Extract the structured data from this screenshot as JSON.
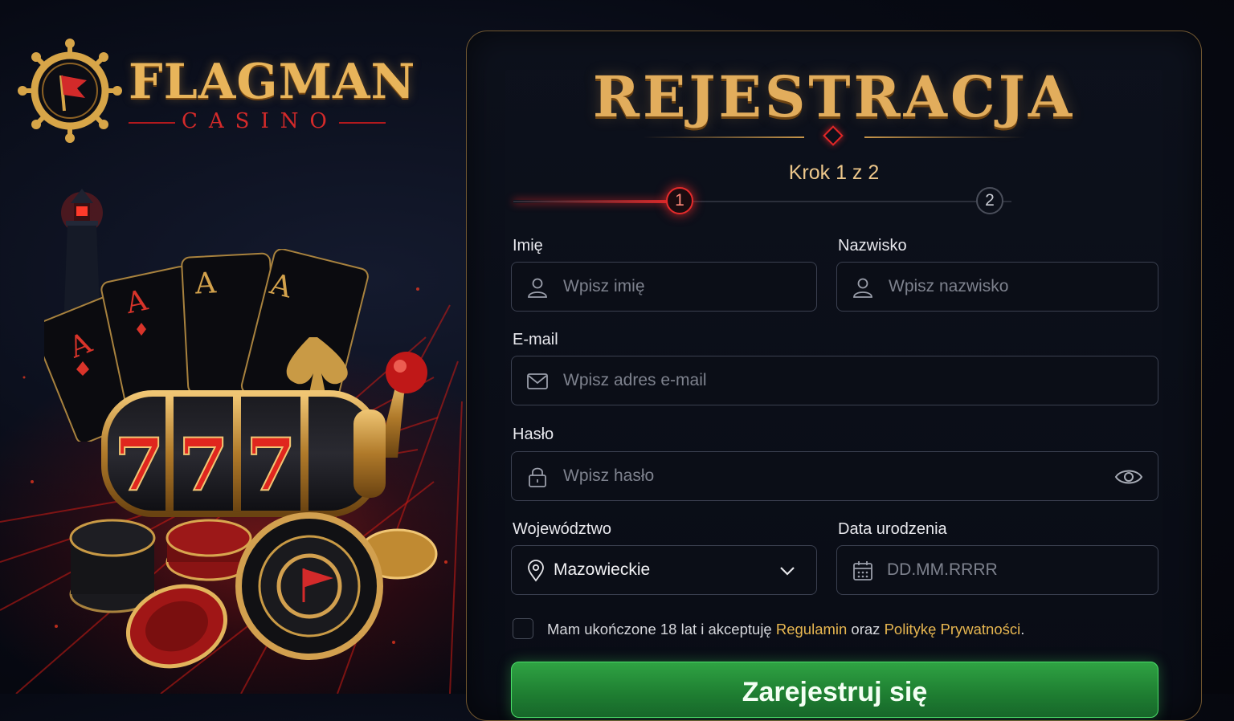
{
  "brand": {
    "name": "FLAGMAN",
    "sub": "CASINO",
    "slot_symbols": [
      "7",
      "7",
      "7"
    ],
    "card_ranks": [
      "A",
      "A",
      "A",
      "A"
    ]
  },
  "form": {
    "title": "REJESTRACJA",
    "step": {
      "text": "Krok 1 z 2",
      "current": 1,
      "total": 2,
      "labels": [
        "1",
        "2"
      ],
      "progress": 0.5
    },
    "first_name": {
      "label": "Imię",
      "placeholder": "Wpisz imię",
      "icon": "user-icon"
    },
    "last_name": {
      "label": "Nazwisko",
      "placeholder": "Wpisz nazwisko",
      "icon": "user-icon"
    },
    "email": {
      "label": "E-mail",
      "placeholder": "Wpisz adres e-mail",
      "icon": "mail-icon"
    },
    "password": {
      "label": "Hasło",
      "placeholder": "Wpisz hasło",
      "icon": "lock-icon",
      "toggle_icon": "eye-icon"
    },
    "region": {
      "label": "Województwo",
      "value": "Mazowieckie",
      "icon": "location-pin-icon",
      "dropdown_icon": "chevron-down-icon"
    },
    "birthdate": {
      "label": "Data urodzenia",
      "placeholder": "DD.MM.RRRR",
      "icon": "calendar-icon"
    },
    "consent": {
      "checked": false,
      "text_before": "Mam ukończone 18 lat i akceptuję ",
      "link_terms": "Regulamin",
      "text_mid": " oraz ",
      "link_privacy": "Politykę Prywatności",
      "text_after": "."
    },
    "submit_label": "Zarejestruj się"
  },
  "colors": {
    "gold": "#e2ad5c",
    "red_accent": "#e52b2b",
    "submit_green": "#2fa343",
    "panel_bg": "#0b0e17"
  }
}
